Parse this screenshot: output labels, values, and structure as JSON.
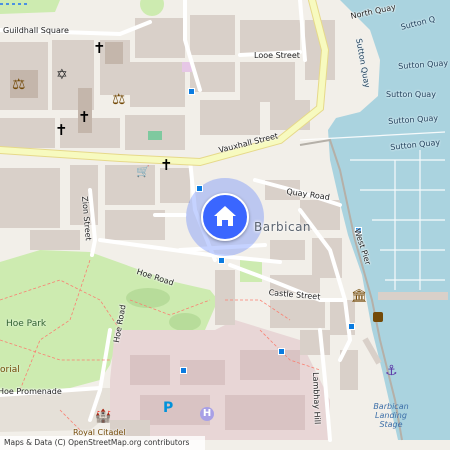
{
  "map": {
    "area_label": "Barbican",
    "streets": {
      "guildhall_square": "Guildhall Square",
      "north_quay": "North Quay",
      "looe_street": "Looe Street",
      "vauxhall_street": "Vauxhall Street",
      "quay_road": "Quay Road",
      "zion_street": "Zion Street",
      "hoe_road_upper": "Hoe Road",
      "hoe_road_lower": "Hoe Road",
      "castle_street": "Castle Street",
      "west_pier": "West Pier",
      "lambhay_hill": "Lambhay Hill",
      "hoe_promenade": "Hoe Promenade"
    },
    "quays": {
      "sutton_q": "Sutton Q",
      "sutton_quay_1": "Sutton Quay",
      "sutton_quay_2": "Sutton Quay",
      "sutton_quay_3": "Sutton Quay",
      "sutton_quay_4": "Sutton Quay",
      "sutton_quay_5": "Sutton Quay"
    },
    "parks": {
      "hoe_park": "Hoe Park",
      "memorial_fragment": "orial"
    },
    "pois": {
      "royal_citadel": "Royal Citadel",
      "barbican_landing_stage": "Barbican Landing Stage"
    },
    "colors": {
      "water": "#aad3df",
      "park": "#cdebb0",
      "building": "#d9d0c9",
      "major_road": "#f7fabf",
      "location": "#3a66ff",
      "transit": "#0a7be0"
    },
    "icons": {
      "location_pin": "home-icon",
      "church": "cross-icon",
      "synagogue": "star-of-david-icon",
      "court": "scales-icon",
      "shop": "shopping-cart-icon",
      "museum": "museum-icon",
      "anchor": "anchor-icon",
      "parking": "parking-icon",
      "hospital": "hospital-icon",
      "castle": "castle-icon"
    },
    "glyphs": {
      "cross": "✝",
      "star": "✡",
      "scales": "⚖",
      "cart": "🛒",
      "anchor": "⚓",
      "parking": "P",
      "hospital": "H",
      "museum": "🏛",
      "castle": "🏰",
      "home": "⌂"
    },
    "attribution": "Maps & Data (C) OpenStreetMap.org contributors"
  }
}
